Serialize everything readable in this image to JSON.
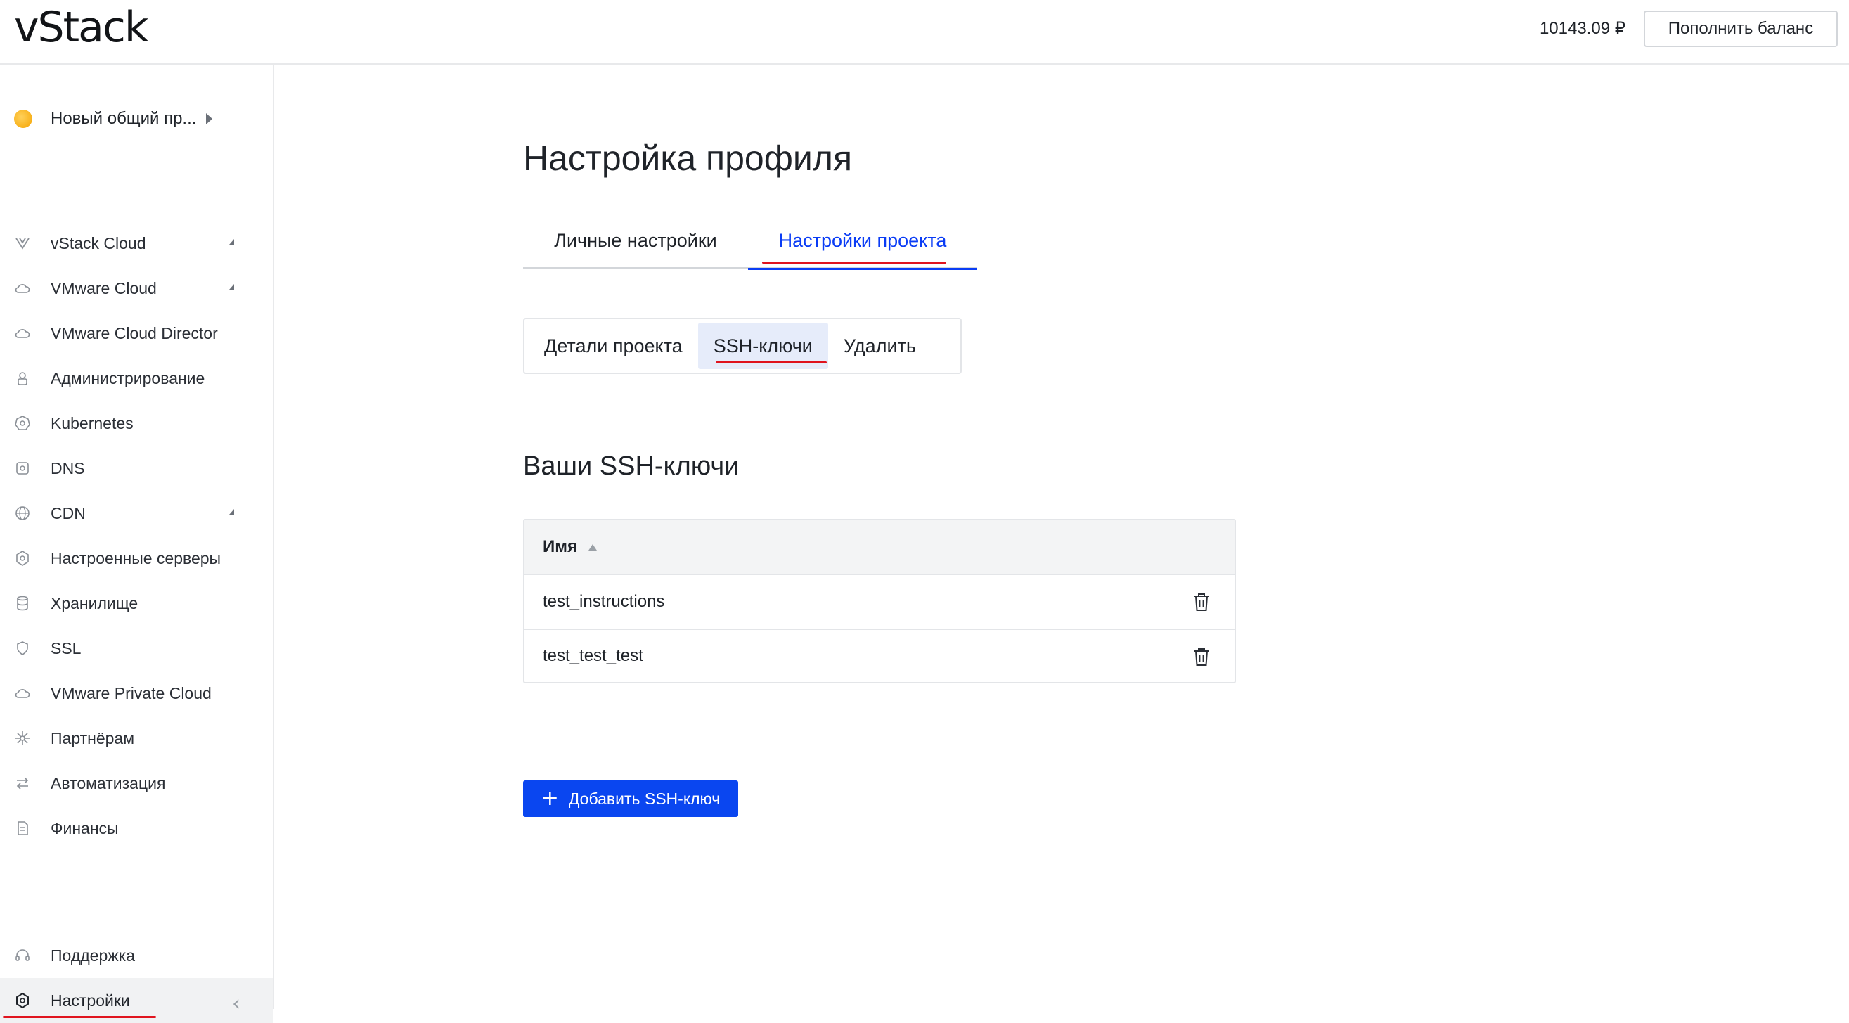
{
  "header": {
    "logo": "vStack",
    "balance": "10143.09 ₽",
    "topup_label": "Пополнить баланс"
  },
  "sidebar": {
    "project_name": "Новый общий пр...",
    "items": [
      {
        "label": "vStack Cloud",
        "icon": "vstack-logo-icon",
        "expandable": true
      },
      {
        "label": "VMware Cloud",
        "icon": "cloud-icon",
        "expandable": true
      },
      {
        "label": "VMware Cloud Director",
        "icon": "cloud-icon",
        "expandable": false
      },
      {
        "label": "Администрирование",
        "icon": "user-lock-icon",
        "expandable": false
      },
      {
        "label": "Kubernetes",
        "icon": "kubernetes-icon",
        "expandable": false
      },
      {
        "label": "DNS",
        "icon": "dns-icon",
        "expandable": false
      },
      {
        "label": "CDN",
        "icon": "globe-icon",
        "expandable": true
      },
      {
        "label": "Настроенные серверы",
        "icon": "server-settings-icon",
        "expandable": false
      },
      {
        "label": "Хранилище",
        "icon": "database-icon",
        "expandable": false
      },
      {
        "label": "SSL",
        "icon": "shield-icon",
        "expandable": false
      },
      {
        "label": "VMware Private Cloud",
        "icon": "cloud-icon",
        "expandable": false
      },
      {
        "label": "Партнёрам",
        "icon": "partners-icon",
        "expandable": false
      },
      {
        "label": "Автоматизация",
        "icon": "arrows-icon",
        "expandable": false
      },
      {
        "label": "Финансы",
        "icon": "document-icon",
        "expandable": false
      }
    ],
    "bottom_items": [
      {
        "label": "Поддержка",
        "icon": "headset-icon"
      },
      {
        "label": "Настройки",
        "icon": "gear-icon"
      }
    ]
  },
  "main": {
    "page_title": "Настройка профиля",
    "tabs": [
      {
        "label": "Личные настройки",
        "active": false
      },
      {
        "label": "Настройки проекта",
        "active": true
      }
    ],
    "subtabs": [
      {
        "label": "Детали проекта",
        "active": false
      },
      {
        "label": "SSH-ключи",
        "active": true
      },
      {
        "label": "Удалить",
        "active": false
      }
    ],
    "section_title": "Ваши SSH-ключи",
    "table": {
      "column_name": "Имя",
      "rows": [
        {
          "name": "test_instructions"
        },
        {
          "name": "test_test_test"
        }
      ]
    },
    "add_button_label": "Добавить SSH-ключ"
  },
  "colors": {
    "accent": "#0a46f0",
    "active_tab": "#0a3cf5",
    "annotation_red": "#e0141e"
  }
}
